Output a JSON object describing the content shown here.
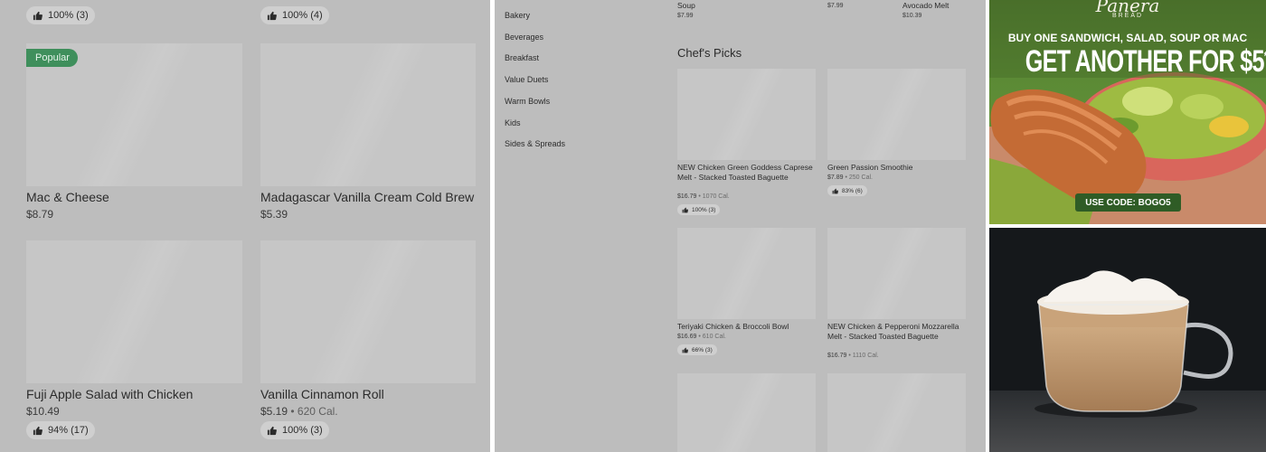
{
  "left_panel": {
    "top_ratings": [
      "100% (3)",
      "100% (4)"
    ],
    "badge": "Popular",
    "items": [
      {
        "title": "Mac & Cheese",
        "price": "$8.79"
      },
      {
        "title": "Madagascar Vanilla Cream Cold Brew",
        "price": "$5.39"
      },
      {
        "title": "Fuji Apple Salad with Chicken",
        "price": "$10.49",
        "rating": "94% (17)"
      },
      {
        "title": "Vanilla Cinnamon Roll",
        "price": "$5.19",
        "calories": "620 Cal.",
        "rating": "100% (3)"
      }
    ]
  },
  "mid_panel": {
    "categories": [
      "Bakery",
      "Beverages",
      "Breakfast",
      "Value Duets",
      "Warm Bowls",
      "Kids",
      "Sides & Spreads"
    ],
    "top_items": [
      {
        "title": "Soup",
        "price": "$7.99"
      },
      {
        "price": "$7.99"
      },
      {
        "title": "Avocado Melt",
        "price": "$10.39"
      }
    ],
    "section_title": "Chef's Picks",
    "items": [
      {
        "title": "NEW Chicken Green Goddess Caprese Melt - Stacked Toasted Baguette",
        "price": "$16.79",
        "calories": "1070 Cal.",
        "rating": "100% (3)"
      },
      {
        "title": "Green Passion Smoothie",
        "price": "$7.89",
        "calories": "250 Cal.",
        "rating": "83% (6)"
      },
      {
        "title": "Teriyaki Chicken & Broccoli Bowl",
        "price": "$16.69",
        "calories": "610 Cal.",
        "rating": "66% (3)"
      },
      {
        "title": "NEW Chicken & Pepperoni Mozzarella Melt - Stacked Toasted Baguette",
        "price": "$16.79",
        "calories": "1110 Cal."
      }
    ]
  },
  "ad": {
    "brand": "Panera",
    "brand_sub": "BREAD",
    "line1": "BUY ONE SANDWICH, SALAD, SOUP OR MAC",
    "line2": "GET ANOTHER FOR $5",
    "line2_mark": "*",
    "code": "USE CODE: BOGO5"
  },
  "colors": {
    "panel_gray": "#bdbdbd",
    "placeholder": "#c6c6c6",
    "popular_green": "#3f8f5c",
    "ad_green": "#5b8a35",
    "code_green": "#2f5c26"
  },
  "icons": {
    "rating": "thumbs-up-icon"
  }
}
